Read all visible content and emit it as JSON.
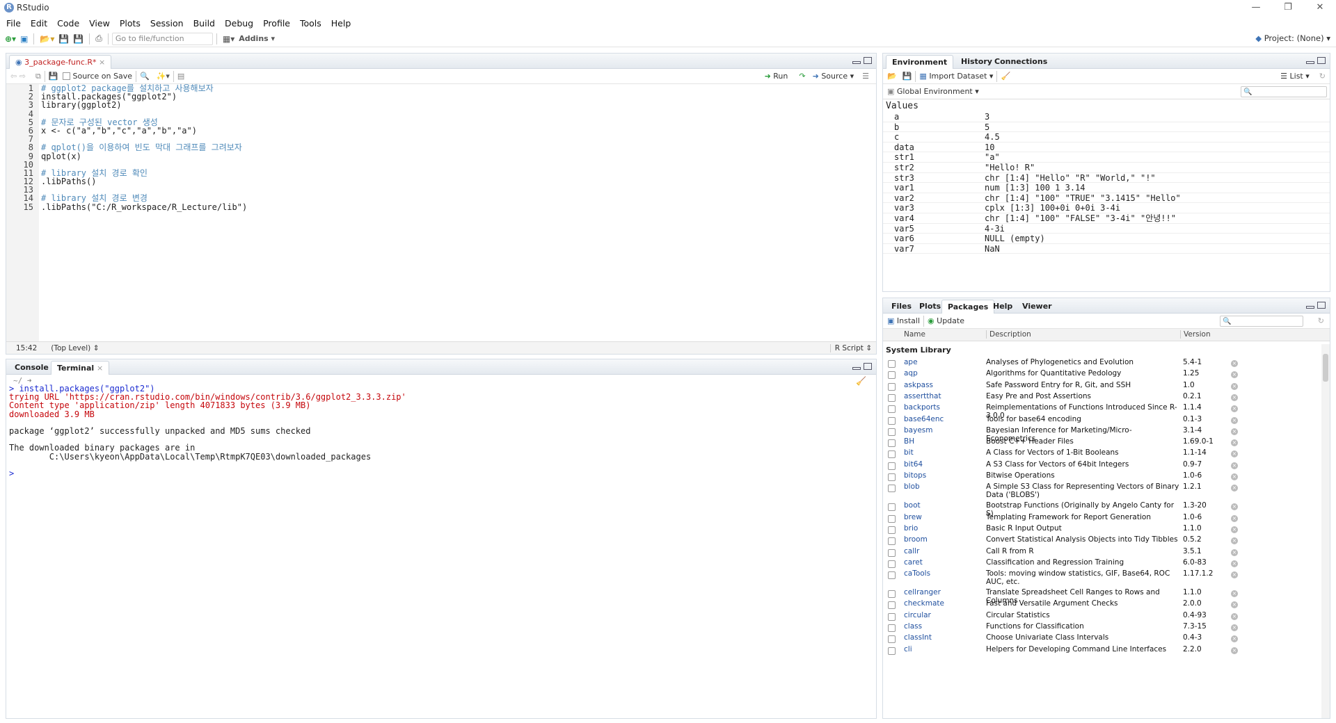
{
  "app": {
    "title": "RStudio",
    "project": "Project: (None)"
  },
  "menu": [
    "File",
    "Edit",
    "Code",
    "View",
    "Plots",
    "Session",
    "Build",
    "Debug",
    "Profile",
    "Tools",
    "Help"
  ],
  "toolbar": {
    "goto_placeholder": "Go to file/function",
    "addins": "Addins"
  },
  "editor": {
    "tab": "3_package-func.R*",
    "source_on_save": "Source on Save",
    "run": "Run",
    "source": "Source",
    "position": "15:42",
    "scope": "(Top Level)",
    "filetype": "R Script",
    "lines": [
      {
        "n": "1",
        "t": "# ggplot2 package를 설치하고 사용해보자",
        "k": "cmt"
      },
      {
        "n": "2",
        "t": "install.packages(\"ggplot2\")",
        "k": ""
      },
      {
        "n": "3",
        "t": "library(ggplot2)",
        "k": ""
      },
      {
        "n": "4",
        "t": "",
        "k": ""
      },
      {
        "n": "5",
        "t": "# 문자로 구성된 vector 생성",
        "k": "cmt"
      },
      {
        "n": "6",
        "t": "x <- c(\"a\",\"b\",\"c\",\"a\",\"b\",\"a\")",
        "k": ""
      },
      {
        "n": "7",
        "t": "",
        "k": ""
      },
      {
        "n": "8",
        "t": "# qplot()을 이용하여 빈도 막대 그래프를 그려보자",
        "k": "cmt"
      },
      {
        "n": "9",
        "t": "qplot(x)",
        "k": ""
      },
      {
        "n": "10",
        "t": "",
        "k": ""
      },
      {
        "n": "11",
        "t": "# library 설치 경로 확인",
        "k": "cmt"
      },
      {
        "n": "12",
        "t": ".libPaths()",
        "k": ""
      },
      {
        "n": "13",
        "t": "",
        "k": ""
      },
      {
        "n": "14",
        "t": "# library 설치 경로 변경",
        "k": "cmt"
      },
      {
        "n": "15",
        "t": ".libPaths(\"C:/R_workspace/R_Lecture/lib\")",
        "k": ""
      }
    ]
  },
  "console": {
    "tabs": [
      "Console",
      "Terminal"
    ],
    "path": "~/",
    "lines": [
      {
        "t": "> install.packages(\"ggplot2\")",
        "k": "blue"
      },
      {
        "t": "trying URL 'https://cran.rstudio.com/bin/windows/contrib/3.6/ggplot2_3.3.3.zip'",
        "k": "red"
      },
      {
        "t": "Content type 'application/zip' length 4071833 bytes (3.9 MB)",
        "k": "red"
      },
      {
        "t": "downloaded 3.9 MB",
        "k": "red"
      },
      {
        "t": "",
        "k": ""
      },
      {
        "t": "package ‘ggplot2’ successfully unpacked and MD5 sums checked",
        "k": ""
      },
      {
        "t": "",
        "k": ""
      },
      {
        "t": "The downloaded binary packages are in",
        "k": ""
      },
      {
        "t": "        C:\\Users\\kyeon\\AppData\\Local\\Temp\\RtmpK7QE03\\downloaded_packages",
        "k": ""
      },
      {
        "t": "",
        "k": ""
      },
      {
        "t": "> ",
        "k": "blue"
      }
    ]
  },
  "env": {
    "tabs": [
      "Environment",
      "History",
      "Connections"
    ],
    "import": "Import Dataset",
    "list": "List",
    "scope": "Global Environment",
    "section": "Values",
    "rows": [
      {
        "n": "a",
        "v": "3"
      },
      {
        "n": "b",
        "v": "5"
      },
      {
        "n": "c",
        "v": "4.5"
      },
      {
        "n": "data",
        "v": "10"
      },
      {
        "n": "str1",
        "v": "\"a\""
      },
      {
        "n": "str2",
        "v": "\"Hello! R\""
      },
      {
        "n": "str3",
        "v": "chr [1:4] \"Hello\" \"R\" \"World,\" \"!\""
      },
      {
        "n": "var1",
        "v": "num [1:3] 100 1 3.14"
      },
      {
        "n": "var2",
        "v": "chr [1:4] \"100\" \"TRUE\" \"3.1415\" \"Hello\""
      },
      {
        "n": "var3",
        "v": "cplx [1:3] 100+0i 0+0i 3-4i"
      },
      {
        "n": "var4",
        "v": "chr [1:4] \"100\" \"FALSE\" \"3-4i\" \"안녕!!\""
      },
      {
        "n": "var5",
        "v": "4-3i"
      },
      {
        "n": "var6",
        "v": "NULL (empty)"
      },
      {
        "n": "var7",
        "v": "NaN"
      }
    ]
  },
  "files": {
    "tabs": [
      "Files",
      "Plots",
      "Packages",
      "Help",
      "Viewer"
    ],
    "install": "Install",
    "update": "Update",
    "cols": [
      "Name",
      "Description",
      "Version"
    ],
    "section": "System Library",
    "packages": [
      {
        "n": "ape",
        "d": "Analyses of Phylogenetics and Evolution",
        "v": "5.4-1"
      },
      {
        "n": "aqp",
        "d": "Algorithms for Quantitative Pedology",
        "v": "1.25"
      },
      {
        "n": "askpass",
        "d": "Safe Password Entry for R, Git, and SSH",
        "v": "1.0"
      },
      {
        "n": "assertthat",
        "d": "Easy Pre and Post Assertions",
        "v": "0.2.1"
      },
      {
        "n": "backports",
        "d": "Reimplementations of Functions Introduced Since R-3.0.0",
        "v": "1.1.4"
      },
      {
        "n": "base64enc",
        "d": "Tools for base64 encoding",
        "v": "0.1-3"
      },
      {
        "n": "bayesm",
        "d": "Bayesian Inference for Marketing/Micro-Econometrics",
        "v": "3.1-4"
      },
      {
        "n": "BH",
        "d": "Boost C++ Header Files",
        "v": "1.69.0-1"
      },
      {
        "n": "bit",
        "d": "A Class for Vectors of 1-Bit Booleans",
        "v": "1.1-14"
      },
      {
        "n": "bit64",
        "d": "A S3 Class for Vectors of 64bit Integers",
        "v": "0.9-7"
      },
      {
        "n": "bitops",
        "d": "Bitwise Operations",
        "v": "1.0-6"
      },
      {
        "n": "blob",
        "d": "A Simple S3 Class for Representing Vectors of Binary Data ('BLOBS')",
        "v": "1.2.1"
      },
      {
        "n": "boot",
        "d": "Bootstrap Functions (Originally by Angelo Canty for S)",
        "v": "1.3-20"
      },
      {
        "n": "brew",
        "d": "Templating Framework for Report Generation",
        "v": "1.0-6"
      },
      {
        "n": "brio",
        "d": "Basic R Input Output",
        "v": "1.1.0"
      },
      {
        "n": "broom",
        "d": "Convert Statistical Analysis Objects into Tidy Tibbles",
        "v": "0.5.2"
      },
      {
        "n": "callr",
        "d": "Call R from R",
        "v": "3.5.1"
      },
      {
        "n": "caret",
        "d": "Classification and Regression Training",
        "v": "6.0-83"
      },
      {
        "n": "caTools",
        "d": "Tools: moving window statistics, GIF, Base64, ROC AUC, etc.",
        "v": "1.17.1.2"
      },
      {
        "n": "cellranger",
        "d": "Translate Spreadsheet Cell Ranges to Rows and Columns",
        "v": "1.1.0"
      },
      {
        "n": "checkmate",
        "d": "Fast and Versatile Argument Checks",
        "v": "2.0.0"
      },
      {
        "n": "circular",
        "d": "Circular Statistics",
        "v": "0.4-93"
      },
      {
        "n": "class",
        "d": "Functions for Classification",
        "v": "7.3-15"
      },
      {
        "n": "classInt",
        "d": "Choose Univariate Class Intervals",
        "v": "0.4-3"
      },
      {
        "n": "cli",
        "d": "Helpers for Developing Command Line Interfaces",
        "v": "2.2.0"
      }
    ]
  }
}
